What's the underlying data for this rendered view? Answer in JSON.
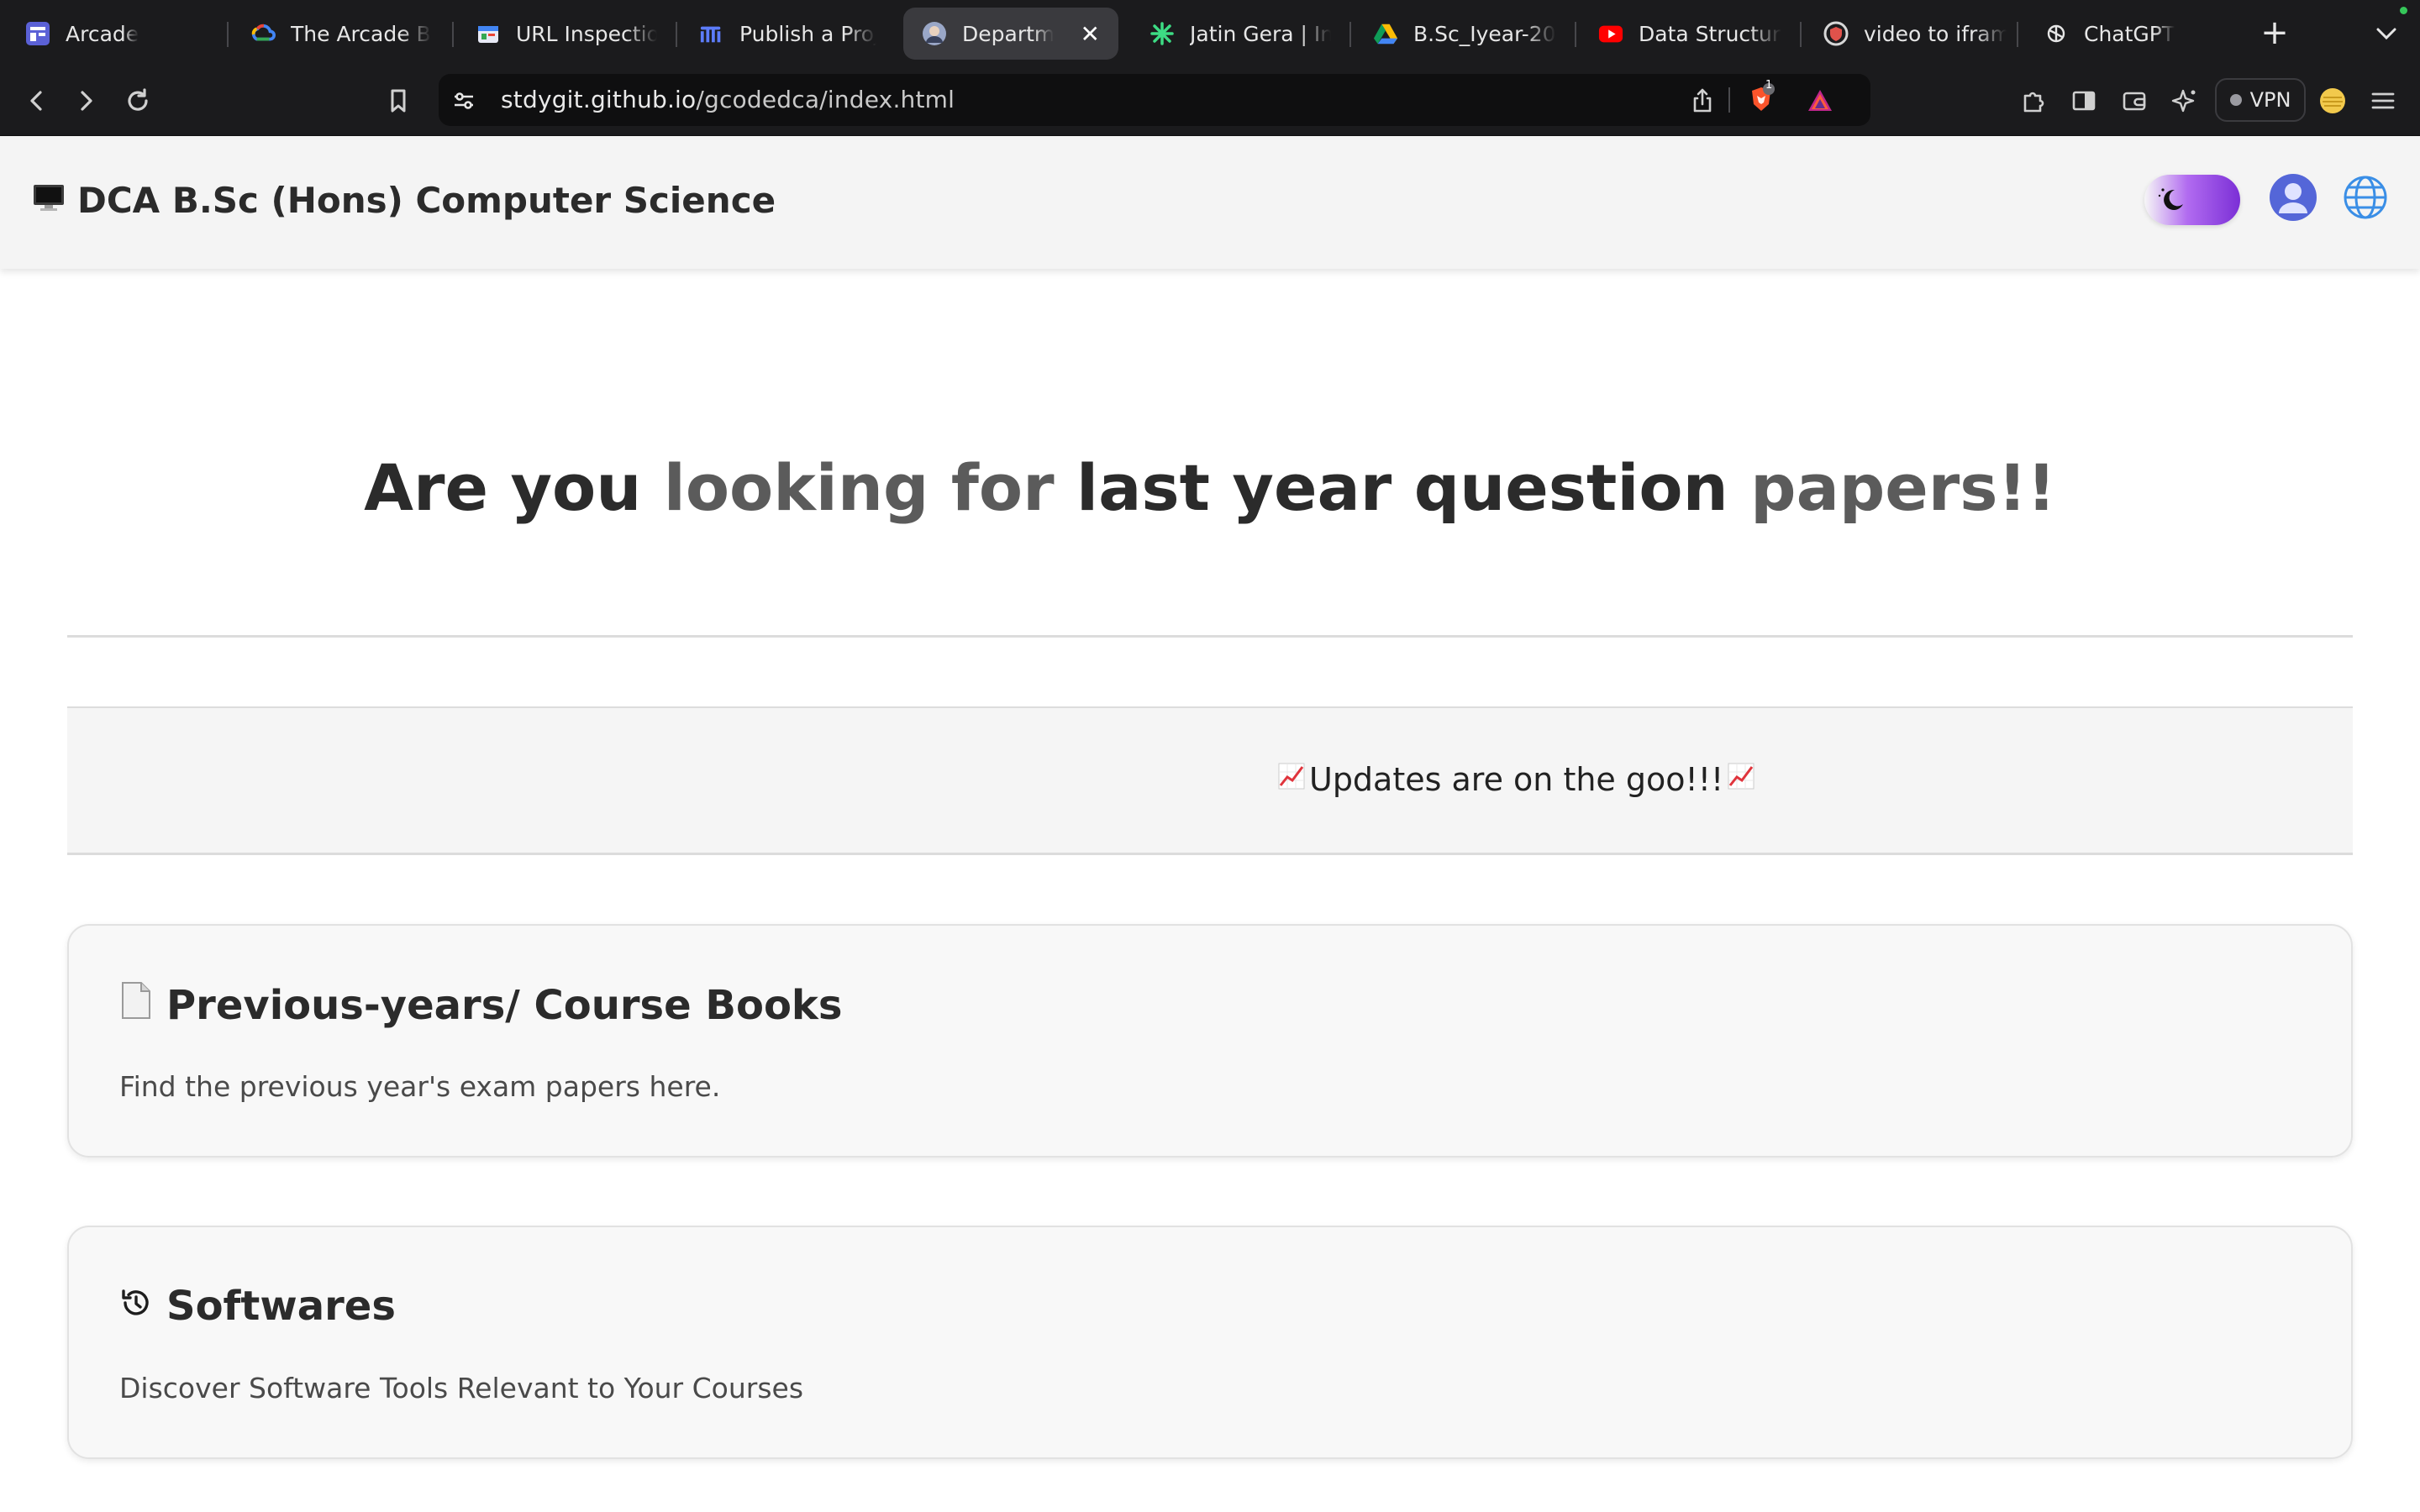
{
  "browser": {
    "tabs": [
      {
        "title": "Arcade",
        "icon": "arcade-icon"
      },
      {
        "title": "The Arcade Ba",
        "icon": "google-cloud-icon"
      },
      {
        "title": "URL Inspection",
        "icon": "search-console-icon"
      },
      {
        "title": "Publish a Proje",
        "icon": "publish-icon"
      },
      {
        "title": "Departmer",
        "icon": "avatar-favicon",
        "active": true
      },
      {
        "title": "Jatin Gera | Ins",
        "icon": "perplexity-icon"
      },
      {
        "title": "B.Sc_Iyear-20",
        "icon": "google-drive-icon"
      },
      {
        "title": "Data Structure",
        "icon": "youtube-icon"
      },
      {
        "title": "video to iframe",
        "icon": "shield-favicon"
      },
      {
        "title": "ChatGPT",
        "icon": "chatgpt-icon"
      }
    ],
    "url": {
      "host": "stdygit.github.io",
      "path": "/gcodedca/index.html"
    },
    "shield_badge": "1",
    "vpn_label": "VPN"
  },
  "header": {
    "title": "DCA B.Sc (Hons) Computer Science",
    "title_icon": "desktop-computer-icon"
  },
  "hero": {
    "part1": "Are you ",
    "part2": "looking for ",
    "part3": "last year question ",
    "part4": "papers!!"
  },
  "updates": {
    "text": "Updates are on the goo!!!",
    "icon": "chart-increasing-icon"
  },
  "cards": [
    {
      "title": "Previous-years/ Course Books",
      "icon": "page-icon",
      "description": "Find the previous year's exam papers here."
    },
    {
      "title": "Softwares",
      "icon": "history-icon",
      "description": "Discover Software Tools Relevant to Your Courses"
    }
  ],
  "colors": {
    "chrome_bg": "#1b1b1d",
    "header_bg": "#f4f4f4",
    "toggle_purple": "#7b2fd6",
    "avatar_blue": "#5466d8",
    "globe_blue": "#3a8ee6"
  }
}
